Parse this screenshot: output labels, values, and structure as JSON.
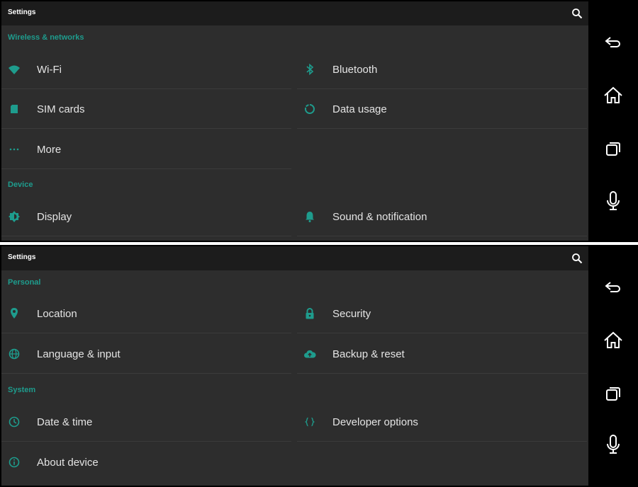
{
  "screens": [
    {
      "title": "Settings",
      "sections": [
        {
          "label": "Wireless & networks",
          "rows": [
            [
              {
                "label": "Wi-Fi",
                "icon": "wifi-icon"
              },
              {
                "label": "Bluetooth",
                "icon": "bluetooth-icon"
              }
            ],
            [
              {
                "label": "SIM cards",
                "icon": "sim-card-icon"
              },
              {
                "label": "Data usage",
                "icon": "data-usage-icon"
              }
            ],
            [
              {
                "label": "More",
                "icon": "more-icon"
              }
            ]
          ]
        },
        {
          "label": "Device",
          "rows": [
            [
              {
                "label": "Display",
                "icon": "display-icon"
              },
              {
                "label": "Sound & notification",
                "icon": "bell-icon"
              }
            ]
          ]
        }
      ]
    },
    {
      "title": "Settings",
      "sections": [
        {
          "label": "Personal",
          "rows": [
            [
              {
                "label": "Location",
                "icon": "location-icon"
              },
              {
                "label": "Security",
                "icon": "lock-icon"
              }
            ],
            [
              {
                "label": "Language & input",
                "icon": "globe-icon"
              },
              {
                "label": "Backup & reset",
                "icon": "cloud-upload-icon"
              }
            ]
          ]
        },
        {
          "label": "System",
          "rows": [
            [
              {
                "label": "Date & time",
                "icon": "clock-icon"
              },
              {
                "label": "Developer options",
                "icon": "braces-icon"
              }
            ],
            [
              {
                "label": "About device",
                "icon": "info-icon"
              }
            ]
          ]
        }
      ]
    }
  ],
  "nav_icons": [
    "back-icon",
    "home-icon",
    "recent-apps-icon",
    "microphone-icon"
  ],
  "colors": {
    "accent": "#1e9c8d",
    "panel": "#2d2d2d",
    "toolbar": "#1c1c1c",
    "text": "#e4e4e4"
  }
}
